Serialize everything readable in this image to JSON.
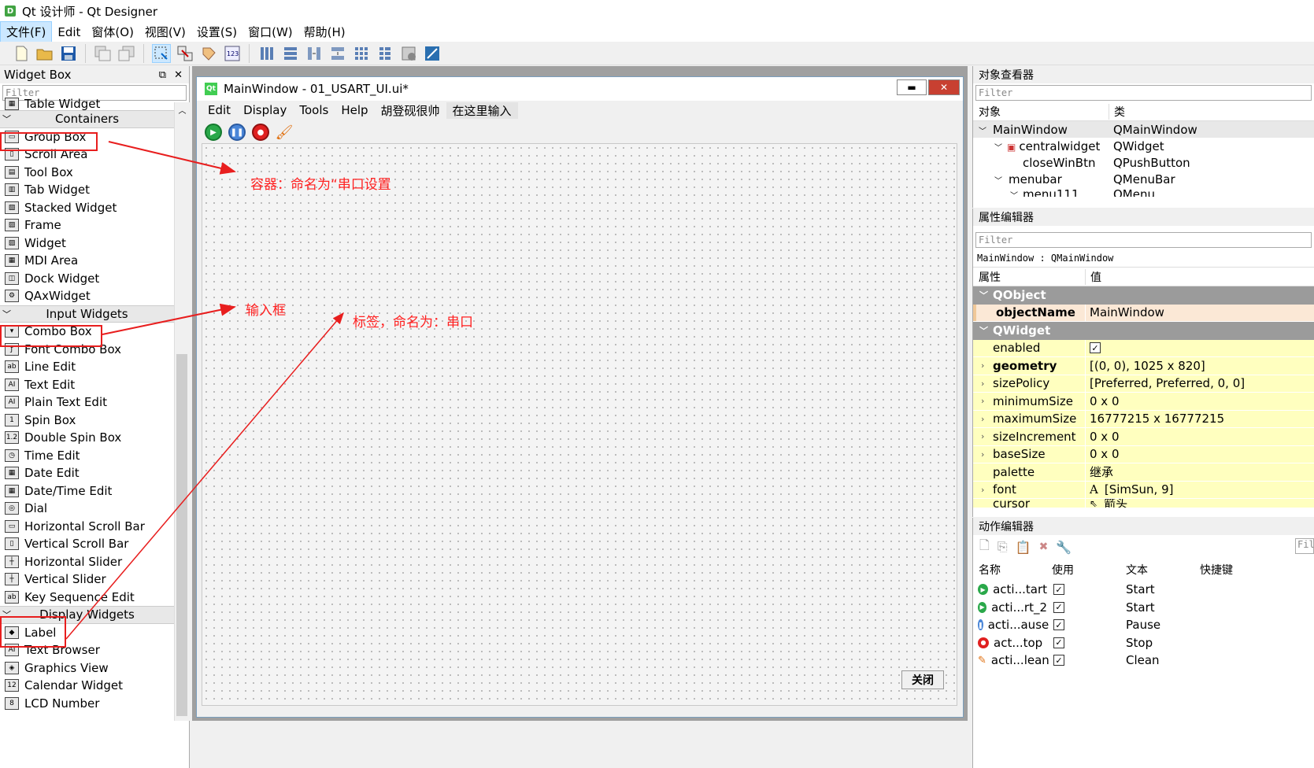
{
  "window": {
    "title": "Qt 设计师 - Qt Designer",
    "app_icon_letter": "D"
  },
  "menubar": [
    "文件(F)",
    "Edit",
    "窗体(O)",
    "视图(V)",
    "设置(S)",
    "窗口(W)",
    "帮助(H)"
  ],
  "widget_box": {
    "title": "Widget Box",
    "filter_placeholder": "Filter",
    "items_top": [
      "Table Widget"
    ],
    "categories": {
      "containers": "Containers",
      "input": "Input Widgets",
      "display": "Display Widgets"
    },
    "containers": [
      "Group Box",
      "Scroll Area",
      "Tool Box",
      "Tab Widget",
      "Stacked Widget",
      "Frame",
      "Widget",
      "MDI Area",
      "Dock Widget",
      "QAxWidget"
    ],
    "inputs": [
      "Combo Box",
      "Font Combo Box",
      "Line Edit",
      "Text Edit",
      "Plain Text Edit",
      "Spin Box",
      "Double Spin Box",
      "Time Edit",
      "Date Edit",
      "Date/Time Edit",
      "Dial",
      "Horizontal Scroll Bar",
      "Vertical Scroll Bar",
      "Horizontal Slider",
      "Vertical Slider",
      "Key Sequence Edit"
    ],
    "displays": [
      "Label",
      "Text Browser",
      "Graphics View",
      "Calendar Widget",
      "LCD Number"
    ]
  },
  "form": {
    "title": "MainWindow - 01_USART_UI.ui*",
    "qt_badge": "Qt",
    "menus": [
      "Edit",
      "Display",
      "Tools",
      "Help",
      "胡登砚很帅",
      "在这里输入"
    ],
    "close_button": "关闭"
  },
  "annotations": {
    "container": "容器：命名为“串口设置",
    "input": "输入框",
    "label": "标签，命名为：串口"
  },
  "object_inspector": {
    "title": "对象查看器",
    "filter_placeholder": "Filter",
    "col_object": "对象",
    "col_class": "类",
    "rows": [
      {
        "name": "MainWindow",
        "cls": "QMainWindow"
      },
      {
        "name": "centralwidget",
        "cls": "QWidget"
      },
      {
        "name": "closeWinBtn",
        "cls": "QPushButton"
      },
      {
        "name": "menubar",
        "cls": "QMenuBar"
      },
      {
        "name": "menu111",
        "cls": "QMenu"
      }
    ]
  },
  "property_editor": {
    "title": "属性编辑器",
    "filter_placeholder": "Filter",
    "context": "MainWindow : QMainWindow",
    "col_prop": "属性",
    "col_val": "值",
    "cat_qobject": "QObject",
    "cat_qwidget": "QWidget",
    "objectName": {
      "n": "objectName",
      "v": "MainWindow"
    },
    "enabled": {
      "n": "enabled",
      "v": "✓"
    },
    "props": [
      {
        "n": "geometry",
        "v": "[(0, 0), 1025 x 820]"
      },
      {
        "n": "sizePolicy",
        "v": "[Preferred, Preferred, 0, 0]"
      },
      {
        "n": "minimumSize",
        "v": "0 x 0"
      },
      {
        "n": "maximumSize",
        "v": "16777215 x 16777215"
      },
      {
        "n": "sizeIncrement",
        "v": "0 x 0"
      },
      {
        "n": "baseSize",
        "v": "0 x 0"
      },
      {
        "n": "palette",
        "v": "继承"
      },
      {
        "n": "font",
        "v": "[SimSun, 9]"
      },
      {
        "n": "cursor",
        "v": "箭头"
      }
    ],
    "font_glyph": "A"
  },
  "action_editor": {
    "title": "动作编辑器",
    "filter_placeholder": "Fil",
    "col_name": "名称",
    "col_used": "使用",
    "col_text": "文本",
    "col_shortcut": "快捷键",
    "rows": [
      {
        "name": "acti...tart",
        "text": "Start"
      },
      {
        "name": "acti...rt_2",
        "text": "Start"
      },
      {
        "name": "acti...ause",
        "text": "Pause"
      },
      {
        "name": "act...top",
        "text": "Stop"
      },
      {
        "name": "acti...lean",
        "text": "Clean"
      }
    ]
  },
  "colors": {
    "annotation": "#ff2020",
    "highlight_row": "#ffffbf",
    "selected": "#cce8ff"
  }
}
